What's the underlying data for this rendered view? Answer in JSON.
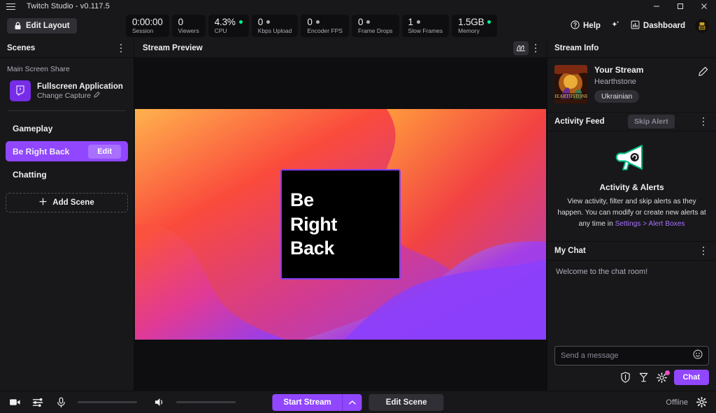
{
  "titlebar": {
    "app_title": "Twitch Studio - v0.117.5",
    "menu_icon": "hamburger-icon",
    "minimize": "minimize-icon",
    "maximize": "maximize-icon",
    "close": "close-icon"
  },
  "toolbar": {
    "edit_layout_label": "Edit Layout",
    "lock_icon": "lock-icon",
    "help_label": "Help",
    "dashboard_label": "Dashboard",
    "sparkle_icon": "sparkle-icon",
    "avatar": "user-avatar"
  },
  "stats": [
    {
      "value": "0:00:00",
      "label": "Session",
      "dot": "none"
    },
    {
      "value": "0",
      "label": "Viewers",
      "dot": "none"
    },
    {
      "value": "4.3%",
      "label": "CPU",
      "dot": "green"
    },
    {
      "value": "0",
      "label": "Kbps Upload",
      "dot": "grey"
    },
    {
      "value": "0",
      "label": "Encoder FPS",
      "dot": "grey"
    },
    {
      "value": "0",
      "label": "Frame Drops",
      "dot": "grey"
    },
    {
      "value": "1",
      "label": "Slow Frames",
      "dot": "grey"
    },
    {
      "value": "1.5GB",
      "label": "Memory",
      "dot": "green"
    }
  ],
  "scenes": {
    "header": "Scenes",
    "section_label": "Main Screen Share",
    "capture_name": "Fullscreen Application",
    "capture_sub": "Change Capture",
    "capture_icon": "twitch-glitch-icon",
    "pencil_icon": "pencil-icon",
    "items": [
      {
        "label": "Gameplay",
        "active": false,
        "edit_label": ""
      },
      {
        "label": "Be Right Back",
        "active": true,
        "edit_label": "Edit"
      },
      {
        "label": "Chatting",
        "active": false,
        "edit_label": ""
      }
    ],
    "add_scene_label": "Add Scene"
  },
  "preview": {
    "header": "Stream Preview",
    "audio_mixer_icon": "audio-waveform-icon",
    "overlay_lines": [
      "Be",
      "Right",
      "Back"
    ],
    "gradient_colors": {
      "orange": "#ffa94d",
      "red": "#f9423a",
      "magenta": "#d13b92",
      "purple": "#8a3ffc",
      "violet": "#7d3ff2"
    }
  },
  "stream_info": {
    "header": "Stream Info",
    "title": "Your Stream",
    "game": "Hearthstone",
    "tag": "Ukrainian",
    "edit_icon": "pencil-icon"
  },
  "activity_feed": {
    "header": "Activity Feed",
    "skip_alert_label": "Skip Alert",
    "megaphone_icon": "megaphone-icon",
    "empty_title": "Activity & Alerts",
    "empty_desc_prefix": "View activity, filter and skip alerts as they happen. You can modify or create new alerts at any time in ",
    "empty_desc_link": "Settings > Alert Boxes"
  },
  "chat": {
    "header": "My Chat",
    "welcome": "Welcome to the chat room!",
    "input_placeholder": "Send a message",
    "emote_icon": "smiley-icon",
    "shield_icon": "shield-icon",
    "bits_icon": "bits-icon",
    "gear_icon": "gear-icon",
    "send_label": "Chat"
  },
  "footer": {
    "camera_icon": "camera-icon",
    "mixer_icon": "sliders-icon",
    "mic_icon": "microphone-icon",
    "speaker_icon": "speaker-icon",
    "start_stream_label": "Start Stream",
    "caret_icon": "chevron-up-icon",
    "edit_scene_label": "Edit Scene",
    "status_label": "Offline",
    "settings_icon": "gear-icon"
  }
}
